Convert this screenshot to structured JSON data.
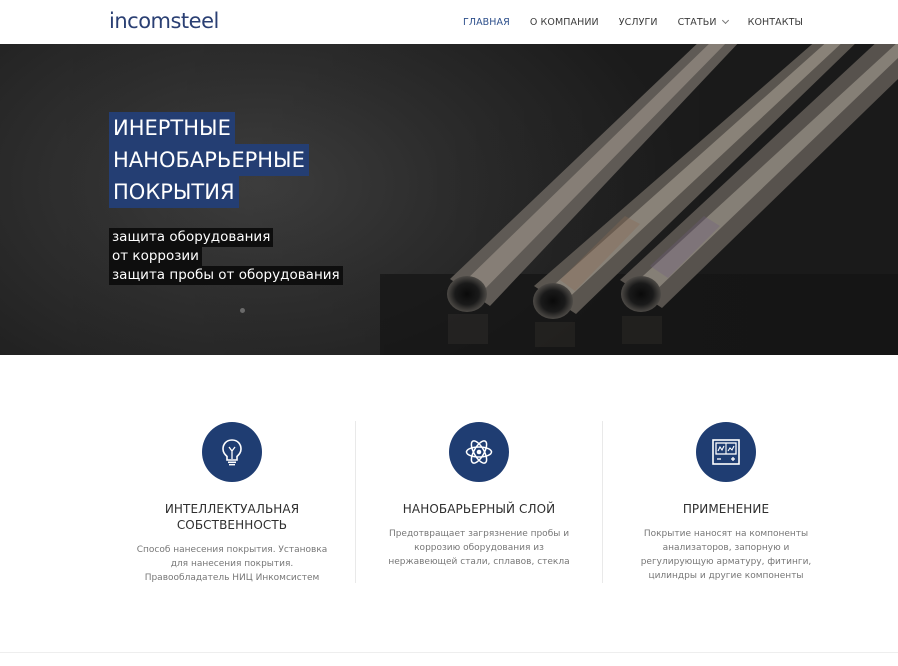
{
  "header": {
    "logo": "incomsteel",
    "nav": [
      {
        "label": "ГЛАВНАЯ",
        "active": true
      },
      {
        "label": "О КОМПАНИИ",
        "active": false
      },
      {
        "label": "УСЛУГИ",
        "active": false
      },
      {
        "label": "СТАТЬИ",
        "active": false,
        "has_dropdown": true
      },
      {
        "label": "КОНТАКТЫ",
        "active": false
      }
    ]
  },
  "hero": {
    "title_lines": [
      "ИНЕРТНЫЕ",
      "НАНОБАРЬЕРНЫЕ",
      "ПОКРЫТИЯ"
    ],
    "subtitle_lines": [
      "защита оборудования",
      "от коррозии",
      "защита пробы от оборудования"
    ]
  },
  "features": [
    {
      "icon": "lightbulb-icon",
      "title_lines": [
        "ИНТЕЛЛЕКТУАЛЬНАЯ",
        "СОБСТВЕННОСТЬ"
      ],
      "text_lines": [
        "Способ нанесения покрытия. Установка",
        "для нанесения покрытия.",
        "Правообладатель НИЦ Инкомсистем"
      ]
    },
    {
      "icon": "atom-icon",
      "title_lines": [
        "НАНОБАРЬЕРНЫЙ СЛОЙ"
      ],
      "text_lines": [
        "Предотвращает загрязнение пробы и",
        "коррозию оборудования из",
        "нержавеющей стали, сплавов, стекла"
      ]
    },
    {
      "icon": "analyzer-icon",
      "title_lines": [
        "ПРИМЕНЕНИЕ"
      ],
      "text_lines": [
        "Покрытие наносят на компоненты",
        "анализаторов, запорную и",
        "регулирующую арматуру, фитинги,",
        "цилиндры и другие компоненты"
      ]
    }
  ],
  "colors": {
    "brand": "#243e73",
    "nav_active": "#2d4f8b",
    "icon_circle": "#1f3d72"
  }
}
